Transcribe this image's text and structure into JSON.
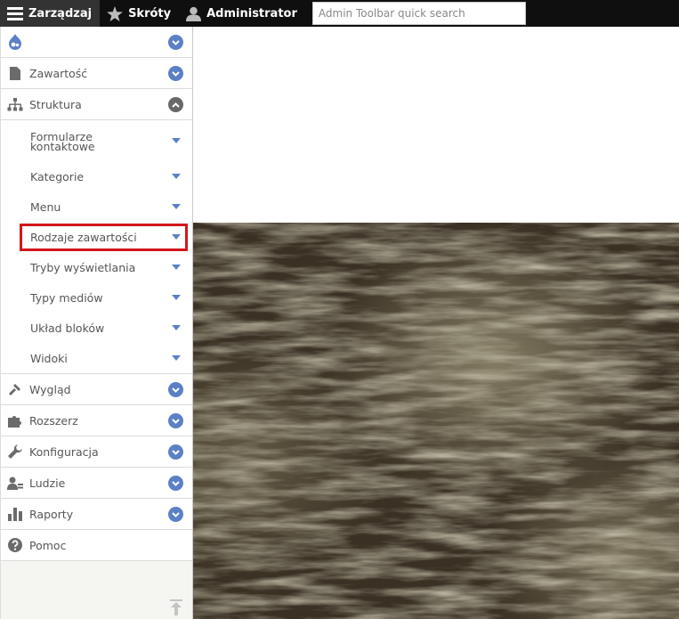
{
  "toolbar": {
    "manage_label": "Zarządzaj",
    "shortcuts_label": "Skróty",
    "user_label": "Administrator",
    "search_placeholder": "Admin Toolbar quick search"
  },
  "menu": {
    "items": [
      {
        "label": "Zawartość",
        "icon": "file-icon"
      },
      {
        "label": "Struktura",
        "icon": "sitemap-icon"
      },
      {
        "label": "Wygląd",
        "icon": "brush-icon"
      },
      {
        "label": "Rozszerz",
        "icon": "puzzle-icon"
      },
      {
        "label": "Konfiguracja",
        "icon": "wrench-icon"
      },
      {
        "label": "Ludzie",
        "icon": "people-icon"
      },
      {
        "label": "Raporty",
        "icon": "bar-chart-icon"
      },
      {
        "label": "Pomoc",
        "icon": "help-icon"
      }
    ],
    "structure_sub": [
      {
        "label": "Formularze kontaktowe"
      },
      {
        "label": "Kategorie"
      },
      {
        "label": "Menu"
      },
      {
        "label": "Rodzaje zawartości"
      },
      {
        "label": "Tryby wyświetlania"
      },
      {
        "label": "Typy mediów"
      },
      {
        "label": "Układ bloków"
      },
      {
        "label": "Widoki"
      }
    ]
  },
  "colors": {
    "toolbar_bg": "#0f0f0f",
    "toggle_blue": "#5b80c6",
    "highlight_red": "#d3161c"
  }
}
